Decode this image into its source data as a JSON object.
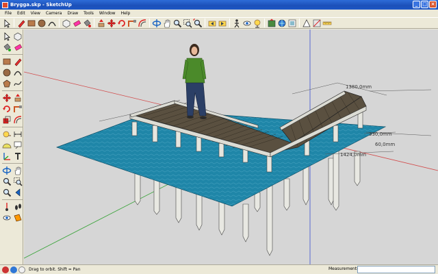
{
  "window": {
    "title": "Brygga.skp - SketchUp",
    "minimize_glyph": "_",
    "maximize_glyph": "□",
    "close_glyph": "×"
  },
  "menu": [
    "File",
    "Edit",
    "View",
    "Camera",
    "Draw",
    "Tools",
    "Window",
    "Help"
  ],
  "toolbar_top_icons": [
    "select-icon",
    "pencil-icon",
    "rectangle-icon",
    "circle-icon",
    "arc-icon",
    "make-component-icon",
    "eraser-icon",
    "paint-bucket-icon",
    "push-pull-icon",
    "move-icon",
    "rotate-icon",
    "follow-me-icon",
    "offset-icon",
    "orbit-icon",
    "pan-icon",
    "zoom-icon",
    "zoom-window-icon",
    "zoom-extents-icon",
    "previous-view-icon",
    "next-view-icon",
    "walk-icon",
    "look-around-icon",
    "position-camera-icon",
    "get-models-icon",
    "share-model-icon",
    "components-icon",
    "styles-icon",
    "section-icon",
    "measure-icon"
  ],
  "toolbar_left_icons": [
    "select-icon",
    "paint-bucket-icon",
    "rectangle-icon",
    "line-icon",
    "circle-icon",
    "arc-icon",
    "polygon-icon",
    "freehand-icon",
    "move-icon",
    "push-pull-icon",
    "rotate-icon",
    "follow-me-icon",
    "scale-icon",
    "offset-icon",
    "tape-measure-icon",
    "dimension-icon",
    "protractor-icon",
    "text-icon",
    "axes-icon",
    "3d-text-icon",
    "orbit-icon",
    "pan-icon",
    "zoom-icon",
    "zoom-window-icon",
    "zoom-extents-icon",
    "previous-icon",
    "position-camera-icon",
    "walk-icon",
    "look-around-icon",
    "section-plane-icon"
  ],
  "dimensions": {
    "d1": "1380,0mm",
    "d2": "1424,0mm",
    "d3": "60,0mm",
    "d4": "330,0mm"
  },
  "status": {
    "hint": "Drag to orbit.  Shift = Pan",
    "measurements_label": "Measurements",
    "measurements_value": ""
  },
  "colors": {
    "water": "#1f86a8",
    "deck": "#5a5040",
    "frame": "#dcdcd4",
    "person_shirt": "#4b8a2a",
    "person_pants": "#2b3f66"
  }
}
